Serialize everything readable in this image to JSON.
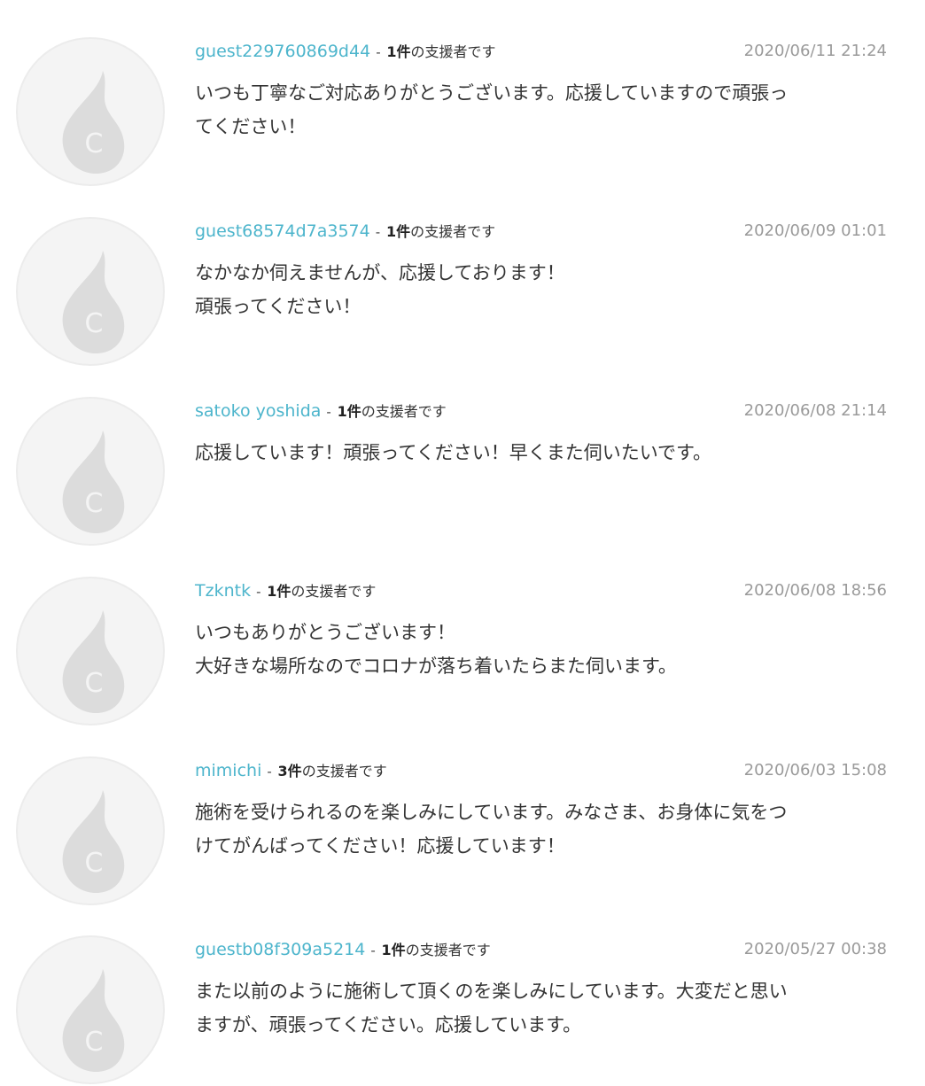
{
  "supporter_suffix": "の支援者です",
  "separator": "-",
  "avatar_icon": "flame-c-logo-icon",
  "colors": {
    "username": "#4db5cc",
    "date": "#9a9a9a",
    "text": "#333333",
    "avatar_bg": "#f4f4f4",
    "avatar_mark": "#dcdcdc"
  },
  "comments": [
    {
      "username": "guest229760869d44",
      "count": "1件",
      "date": "2020/06/11 21:24",
      "text": "いつも丁寧なご対応ありがとうございます。応援していますので頑張っ\nてください！"
    },
    {
      "username": "guest68574d7a3574",
      "count": "1件",
      "date": "2020/06/09 01:01",
      "text": "なかなか伺えませんが、応援しております！\n頑張ってください！"
    },
    {
      "username": "satoko yoshida",
      "count": "1件",
      "date": "2020/06/08 21:14",
      "text": "応援しています！頑張ってください！早くまた伺いたいです。"
    },
    {
      "username": "Tzkntk",
      "count": "1件",
      "date": "2020/06/08 18:56",
      "text": "いつもありがとうございます！\n大好きな場所なのでコロナが落ち着いたらまた伺います。"
    },
    {
      "username": "mimichi",
      "count": "3件",
      "date": "2020/06/03 15:08",
      "text": "施術を受けられるのを楽しみにしています。みなさま、お身体に気をつ\nけてがんばってください！応援しています！"
    },
    {
      "username": "guestb08f309a5214",
      "count": "1件",
      "date": "2020/05/27 00:38",
      "text": "また以前のように施術して頂くのを楽しみにしています。大変だと思い\nますが、頑張ってください。応援しています。"
    }
  ]
}
